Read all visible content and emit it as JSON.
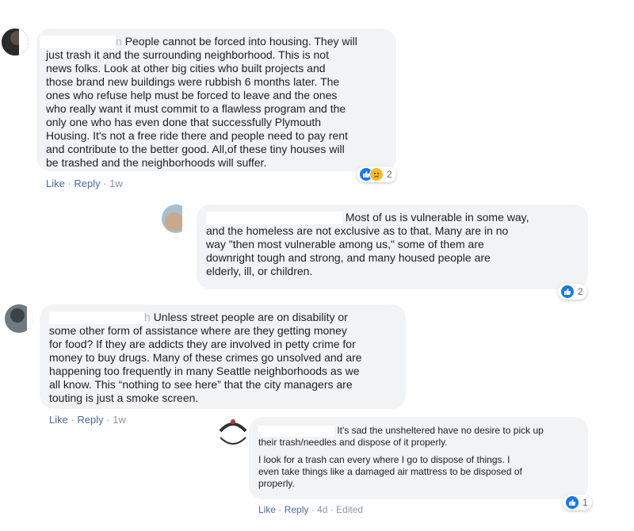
{
  "comments": [
    {
      "text": "People cannot be forced into housing. They will\njust trash it and the surrounding neighborhood. This is not\nnews folks. Look at other big cities who built projects and\nthose brand new buildings were rubbish 6 months later. The\nones who refuse help must be forced to leave and the ones\nwho really want it must commit to a flawless program and the\nonly one who has even done that successfully Plymouth\nHousing. It's not a free ride there and people need to pay rent\nand contribute to the better good. All,of these tiny houses will\nbe trashed and the neighborhoods will suffer.",
      "name_tail": "n",
      "actions": {
        "like": "Like",
        "reply": "Reply",
        "time": "1w"
      },
      "reactions": {
        "count": "2",
        "icons": [
          "like-icon",
          "sad-icon"
        ]
      }
    },
    {
      "text": "Most of us is vulnerable in some way,\nand the homeless are not exclusive as to that. Many are in no\nway \"then most vulnerable among us,\" some of them are\ndownright tough and strong, and many housed people are\nelderly, ill, or children.",
      "reactions": {
        "count": "2",
        "icons": [
          "like-icon"
        ]
      }
    },
    {
      "text": "Unless street people are on disability or\nsome other form of assistance where are they getting money\nfor food? If they are addicts they are involved in petty crime for\nmoney to buy drugs. Many of these crimes go unsolved and are\nhappening too frequently in many Seattle neighborhoods as we\nall know. This “nothing to see here” that the city managers are\ntouting is just a smoke screen.",
      "name_tail": "h",
      "actions": {
        "like": "Like",
        "reply": "Reply",
        "time": "1w"
      }
    },
    {
      "text_p1": "It's sad the unsheltered have no desire to pick up\ntheir trash/needles and dispose of it properly.",
      "text_p2": "I look for a trash can every where I go to dispose of things. I\neven take things like a damaged air mattress to be disposed of\nproperly.",
      "actions": {
        "like": "Like",
        "reply": "Reply",
        "time": "4d",
        "edited": "Edited"
      },
      "reactions": {
        "count": "1",
        "icons": [
          "like-icon"
        ]
      }
    }
  ]
}
